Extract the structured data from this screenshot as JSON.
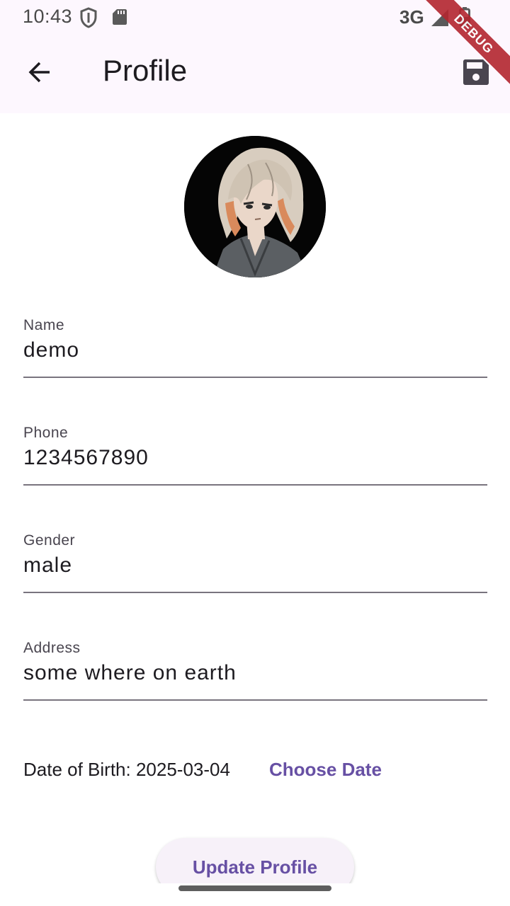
{
  "status_bar": {
    "time": "10:43",
    "network": "3G"
  },
  "app_bar": {
    "title": "Profile"
  },
  "debug_banner": {
    "label": "DEBUG"
  },
  "fields": [
    {
      "label": "Name",
      "value": "demo"
    },
    {
      "label": "Phone",
      "value": "1234567890"
    },
    {
      "label": "Gender",
      "value": "male"
    },
    {
      "label": "Address",
      "value": "some where on earth"
    }
  ],
  "dob": {
    "text": "Date of Birth: 2025-03-04",
    "choose_label": "Choose Date"
  },
  "actions": {
    "update_label": "Update Profile"
  },
  "colors": {
    "app_bar_bg": "#fdf7fe",
    "accent": "#6750a4",
    "underline": "#79747e",
    "debug": "#b3262f"
  },
  "icons": {
    "back": "arrow-back-icon",
    "save": "save-icon"
  }
}
